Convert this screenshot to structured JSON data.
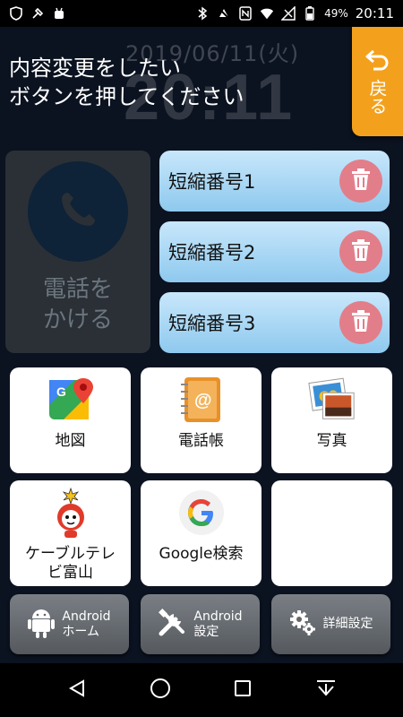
{
  "status": {
    "time": "20:11",
    "battery": "49%"
  },
  "clock": {
    "date": "2019/06/11(火)",
    "time": "20:11"
  },
  "instruction": "内容変更をしたい\nボタンを押してください",
  "back": {
    "label": "戻る"
  },
  "call": {
    "label": "電話を\nかける"
  },
  "speed_dial": [
    {
      "label": "短縮番号1"
    },
    {
      "label": "短縮番号2"
    },
    {
      "label": "短縮番号3"
    }
  ],
  "apps": [
    {
      "label": "地図",
      "icon": "maps-icon"
    },
    {
      "label": "電話帳",
      "icon": "contacts-icon"
    },
    {
      "label": "写真",
      "icon": "photos-icon"
    },
    {
      "label": "ケーブルテレ\nビ富山",
      "icon": "cable-tv-icon"
    },
    {
      "label": "Google検索",
      "icon": "google-icon"
    },
    {
      "label": "",
      "icon": ""
    }
  ],
  "bottom": [
    {
      "label": "Android\nホーム",
      "icon": "android-icon"
    },
    {
      "label": "Android\n設定",
      "icon": "tools-icon"
    },
    {
      "label": "詳細設定",
      "icon": "gear-icon"
    }
  ],
  "colors": {
    "accent": "#f3a11d",
    "speed_dial": "#a7d6f4",
    "trash": "#e27e8a"
  }
}
